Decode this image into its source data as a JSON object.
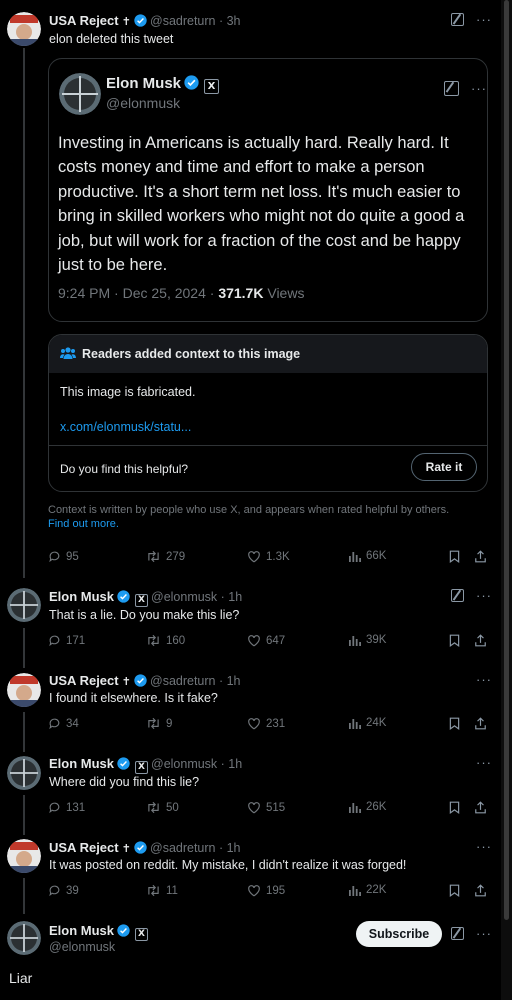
{
  "colors": {
    "accent": "#1d9bf0",
    "background": "#000000",
    "muted": "#71767b",
    "verified": "#1d9bf0"
  },
  "tweets": [
    {
      "name": "USA Reject",
      "suffix": "✝",
      "handle": "@sadreturn",
      "time": "3h",
      "text": "elon deleted this tweet",
      "stats": {
        "replies": "95",
        "reposts": "279",
        "likes": "1.3K",
        "views": "66K"
      }
    },
    {
      "name": "Elon Musk",
      "handle": "@elonmusk",
      "time": "1h",
      "text": "That is a lie. Do you make this lie?",
      "stats": {
        "replies": "171",
        "reposts": "160",
        "likes": "647",
        "views": "39K"
      }
    },
    {
      "name": "USA Reject",
      "suffix": "✝",
      "handle": "@sadreturn",
      "time": "1h",
      "text": "I found it elsewhere. Is it fake?",
      "stats": {
        "replies": "34",
        "reposts": "9",
        "likes": "231",
        "views": "24K"
      }
    },
    {
      "name": "Elon Musk",
      "handle": "@elonmusk",
      "time": "1h",
      "text": "Where did you find this lie?",
      "stats": {
        "replies": "131",
        "reposts": "50",
        "likes": "515",
        "views": "26K"
      }
    },
    {
      "name": "USA Reject",
      "suffix": "✝",
      "handle": "@sadreturn",
      "time": "1h",
      "text": "It was posted on reddit. My mistake, I didn't realize it was forged!",
      "stats": {
        "replies": "39",
        "reposts": "11",
        "likes": "195",
        "views": "22K"
      }
    }
  ],
  "embedded": {
    "name": "Elon Musk",
    "handle": "@elonmusk",
    "body": "Investing in Americans is actually hard. Really hard. It costs money and time and effort to make a person productive. It's a short term net loss. It's much easier to bring in skilled workers who might not do quite a good a job, but will work for a fraction of the cost and be happy just to be here.",
    "timestamp": "9:24 PM · Dec 25, 2024 · ",
    "views_count": "371.7K",
    "views_label": "Views"
  },
  "note": {
    "title": "Readers added context to this image",
    "text": "This image is fabricated.",
    "link": "x.com/elonmusk/statu...",
    "question": "Do you find this helpful?",
    "rate_label": "Rate it",
    "footer": "Context is written by people who use X, and appears when rated helpful by others.",
    "footer_link": "Find out more."
  },
  "final": {
    "name": "Elon Musk",
    "handle": "@elonmusk",
    "subscribe_label": "Subscribe",
    "text": "Liar"
  },
  "icons": {
    "verified": "verified-badge-icon",
    "affiliate": "x-affiliate-icon",
    "grok": "grok-icon",
    "more": "more-icon",
    "reply": "reply-icon",
    "repost": "repost-icon",
    "like": "like-icon",
    "views": "views-icon",
    "bookmark": "bookmark-icon",
    "share": "share-icon"
  }
}
